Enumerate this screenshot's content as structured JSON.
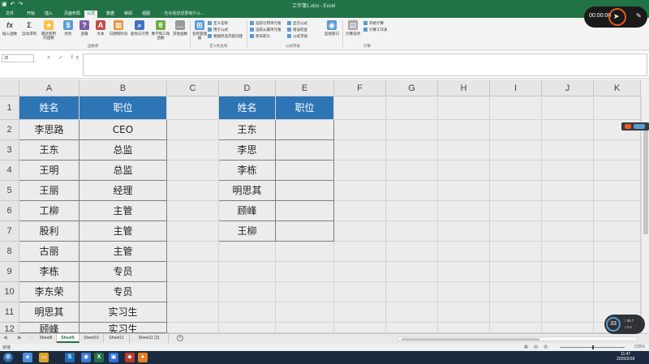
{
  "window": {
    "title": "工作簿1.xlsx - Excel"
  },
  "ribbon": {
    "tabs": [
      "文件",
      "开始",
      "插入",
      "页面布局",
      "公式",
      "数据",
      "审阅",
      "视图"
    ],
    "active_tab": "公式",
    "tell_me": "告诉我您想要做什么...",
    "groups": {
      "library_label": "函数库",
      "names_label": "定义的名称",
      "audit_label": "公式审核",
      "calc_label": "计算"
    },
    "buttons": {
      "insert_function": "插入函数",
      "autosum": "自动求和",
      "recent": "最近使用的函数",
      "financial": "财务",
      "logical": "逻辑",
      "text": "文本",
      "datetime": "日期和时间",
      "lookup": "查找与引用",
      "math": "数学和三角函数",
      "more": "其他函数",
      "name_manager": "名称管理器",
      "watch": "监视窗口",
      "calc_options": "计算选项"
    },
    "small": {
      "define_name": "定义名称",
      "use_in_formula": "用于公式",
      "create_from_sel": "根据所选内容创建",
      "trace_precedents": "追踪引用单元格",
      "trace_dependents": "追踪从属单元格",
      "remove_arrows": "移去箭头",
      "show_formulas": "显示公式",
      "error_check": "错误检查",
      "evaluate": "公式求值",
      "calc_now": "开始计算",
      "calc_sheet": "计算工作表"
    }
  },
  "formula_bar": {
    "name_box": "J5",
    "buttons": "× ✓ fx",
    "value": ""
  },
  "grid": {
    "columns": [
      "A",
      "B",
      "C",
      "D",
      "E",
      "F",
      "G",
      "H",
      "I",
      "J",
      "K"
    ],
    "rows": [
      "1",
      "2",
      "3",
      "4",
      "5",
      "6",
      "7",
      "8",
      "9",
      "10",
      "11",
      "12"
    ],
    "table1": {
      "headers": [
        "姓名",
        "职位"
      ],
      "rows": [
        [
          "李思路",
          "CEO"
        ],
        [
          "王东",
          "总监"
        ],
        [
          "王明",
          "总监"
        ],
        [
          "王丽",
          "经理"
        ],
        [
          "工柳",
          "主管"
        ],
        [
          "股利",
          "主管"
        ],
        [
          "古丽",
          "主管"
        ],
        [
          "李栋",
          "专员"
        ],
        [
          "李东荣",
          "专员"
        ],
        [
          "明思其",
          "实习生"
        ],
        [
          "顾峰",
          "实习生"
        ]
      ]
    },
    "table2": {
      "headers": [
        "姓名",
        "职位"
      ],
      "names": [
        "王东",
        "李思",
        "李栋",
        "明思其",
        "顾峰",
        "王柳"
      ]
    }
  },
  "sheets": {
    "tabs": [
      "Sheet8",
      "Sheet9",
      "Sheet10",
      "Sheet11",
      "Sheet11 (2)"
    ],
    "active": "Sheet9"
  },
  "status": {
    "ready": "就绪",
    "zoom": "215%"
  },
  "overlay": {
    "rec_time": "00:00:00",
    "speed_pct": "33",
    "up": "↑ 30.7",
    "down": "↓ 0.4"
  },
  "taskbar": {
    "clock_time": "11:47",
    "clock_date": "2020/2/28"
  }
}
